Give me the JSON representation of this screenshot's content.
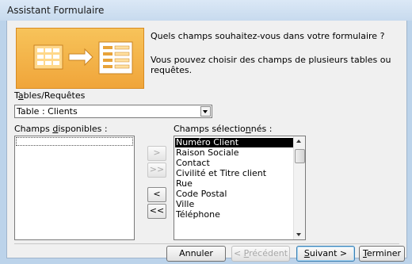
{
  "window": {
    "title": "Assistant Formulaire"
  },
  "intro": {
    "question": "Quels champs souhaitez-vous dans votre formulaire ?",
    "hint": "Vous pouvez choisir des champs de plusieurs tables ou requêtes."
  },
  "tables": {
    "label_pre": "T",
    "label_accel": "a",
    "label_post": "bles/Requêtes",
    "selected": "Table : Clients"
  },
  "available": {
    "label_pre": "Champs ",
    "label_accel": "d",
    "label_post": "isponibles :",
    "items": []
  },
  "selected_fields": {
    "label_pre": "Champs sélectio",
    "label_accel": "n",
    "label_post": "nés :",
    "items": [
      "Numéro Client",
      "Raison Sociale",
      "Contact",
      "Civilité et Titre client",
      "Rue",
      "Code Postal",
      "Ville",
      "Téléphone"
    ],
    "selected_index": 0
  },
  "move_buttons": {
    "add": ">",
    "add_all": ">>",
    "remove": "<",
    "remove_all": "<<"
  },
  "buttons": {
    "cancel": "Annuler",
    "back_pre": "< ",
    "back_accel": "P",
    "back_post": "récédent",
    "next_accel": "S",
    "next_post": "uivant >",
    "finish_accel": "T",
    "finish_post": "erminer"
  }
}
